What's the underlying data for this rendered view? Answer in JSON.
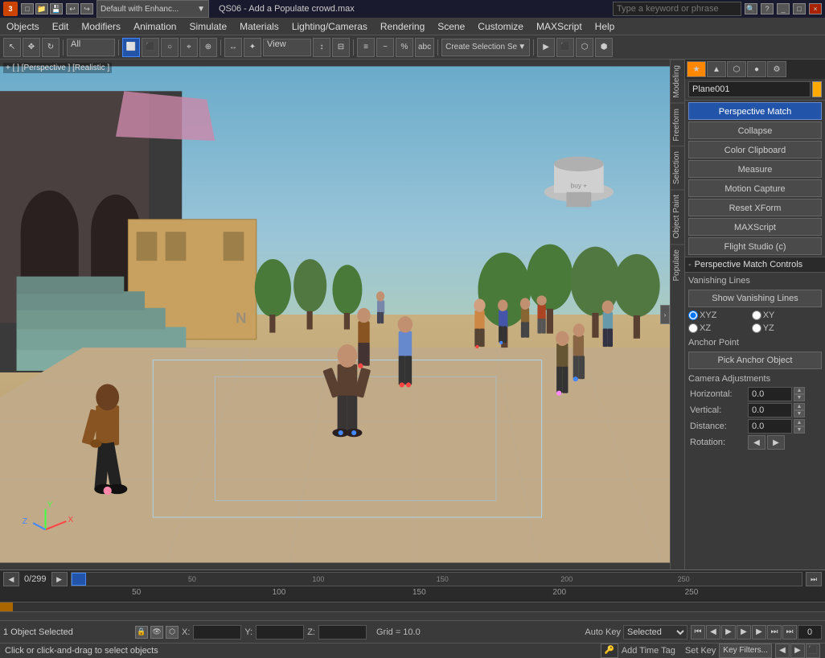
{
  "titlebar": {
    "app_icon": "3dsmax-icon",
    "preset_dropdown": "Default with Enhanc...",
    "file_title": "QS06 - Add a Populate crowd.max",
    "search_placeholder": "Type a keyword or phrase",
    "controls": [
      "_",
      "□",
      "×"
    ]
  },
  "menubar": {
    "items": [
      "Objects",
      "Edit",
      "Modifiers",
      "Animation",
      "Simulate",
      "Materials",
      "Lighting/Cameras",
      "Rendering",
      "Scene",
      "Customize",
      "MAXScript",
      "Help"
    ]
  },
  "toolbar": {
    "create_selection_label": "Create Selection Se",
    "all_dropdown": "All",
    "view_dropdown": "View",
    "separator_positions": [
      3,
      7,
      12
    ]
  },
  "viewport": {
    "label": "+ [ ] [Perspective ] [Realistic ]",
    "axis_labels": {
      "x": "X",
      "y": "Y",
      "z": "Z"
    }
  },
  "side_labels": [
    "Modeling",
    "Freeform",
    "Selection",
    "Object Paint",
    "Populate"
  ],
  "right_panel": {
    "tabs": [
      "★",
      "▲",
      "⬡",
      "●",
      "⚙"
    ],
    "object_name": "Plane001",
    "object_color": "#ffaa00",
    "utility_buttons": [
      {
        "label": "Perspective Match",
        "active": true
      },
      {
        "label": "Collapse",
        "active": false
      },
      {
        "label": "Color Clipboard",
        "active": false
      },
      {
        "label": "Measure",
        "active": false
      },
      {
        "label": "Motion Capture",
        "active": false
      },
      {
        "label": "Reset XForm",
        "active": false
      },
      {
        "label": "MAXScript",
        "active": false
      },
      {
        "label": "Flight Studio (c)",
        "active": false
      }
    ],
    "perspective_match_section": {
      "title": "Perspective Match Controls",
      "vanishing_lines_label": "Vanishing Lines",
      "show_vl_button": "Show Vanishing Lines",
      "radio_options": [
        {
          "label": "XYZ",
          "name": "vl",
          "value": "xyz",
          "checked": true
        },
        {
          "label": "XY",
          "name": "vl",
          "value": "xy",
          "checked": false
        },
        {
          "label": "XZ",
          "name": "vl",
          "value": "xz",
          "checked": false
        },
        {
          "label": "YZ",
          "name": "vl",
          "value": "yz",
          "checked": false
        }
      ],
      "anchor_point_label": "Anchor Point",
      "pick_anchor_button": "Pick Anchor Object",
      "camera_adjustments_label": "Camera Adjustments",
      "fields": [
        {
          "label": "Horizontal:",
          "value": "0.0"
        },
        {
          "label": "Vertical:",
          "value": "0.0"
        },
        {
          "label": "Distance:",
          "value": "0.0"
        },
        {
          "label": "Rotation:",
          "value": null,
          "type": "arrows"
        }
      ]
    }
  },
  "timeline": {
    "position": "0",
    "total": "299",
    "ticks": [
      "50",
      "100",
      "150",
      "200",
      "250"
    ]
  },
  "statusbar": {
    "object_selected": "1 Object Selected",
    "x_label": "X:",
    "y_label": "Y:",
    "z_label": "Z:",
    "grid": "Grid = 10.0",
    "autokey_label": "Auto Key",
    "selected_dropdown": "Selected",
    "set_key_label": "Set Key",
    "key_filters": "Key Filters...",
    "frame_display": "0",
    "bottom_message": "Click or click-and-drag to select objects",
    "add_time_tag": "Add Time Tag"
  }
}
